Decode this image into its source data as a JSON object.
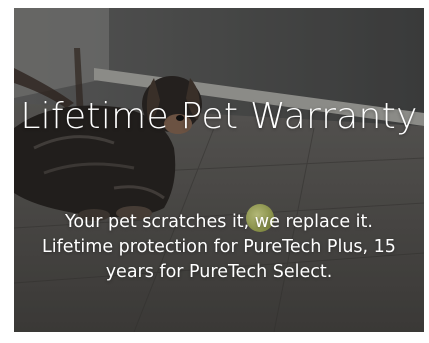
{
  "promo": {
    "headline": "Lifetime Pet Warranty",
    "body": "Your pet scratches it, we replace it. Lifetime protection for PureTech Plus, 15 years for PureTech Select."
  }
}
